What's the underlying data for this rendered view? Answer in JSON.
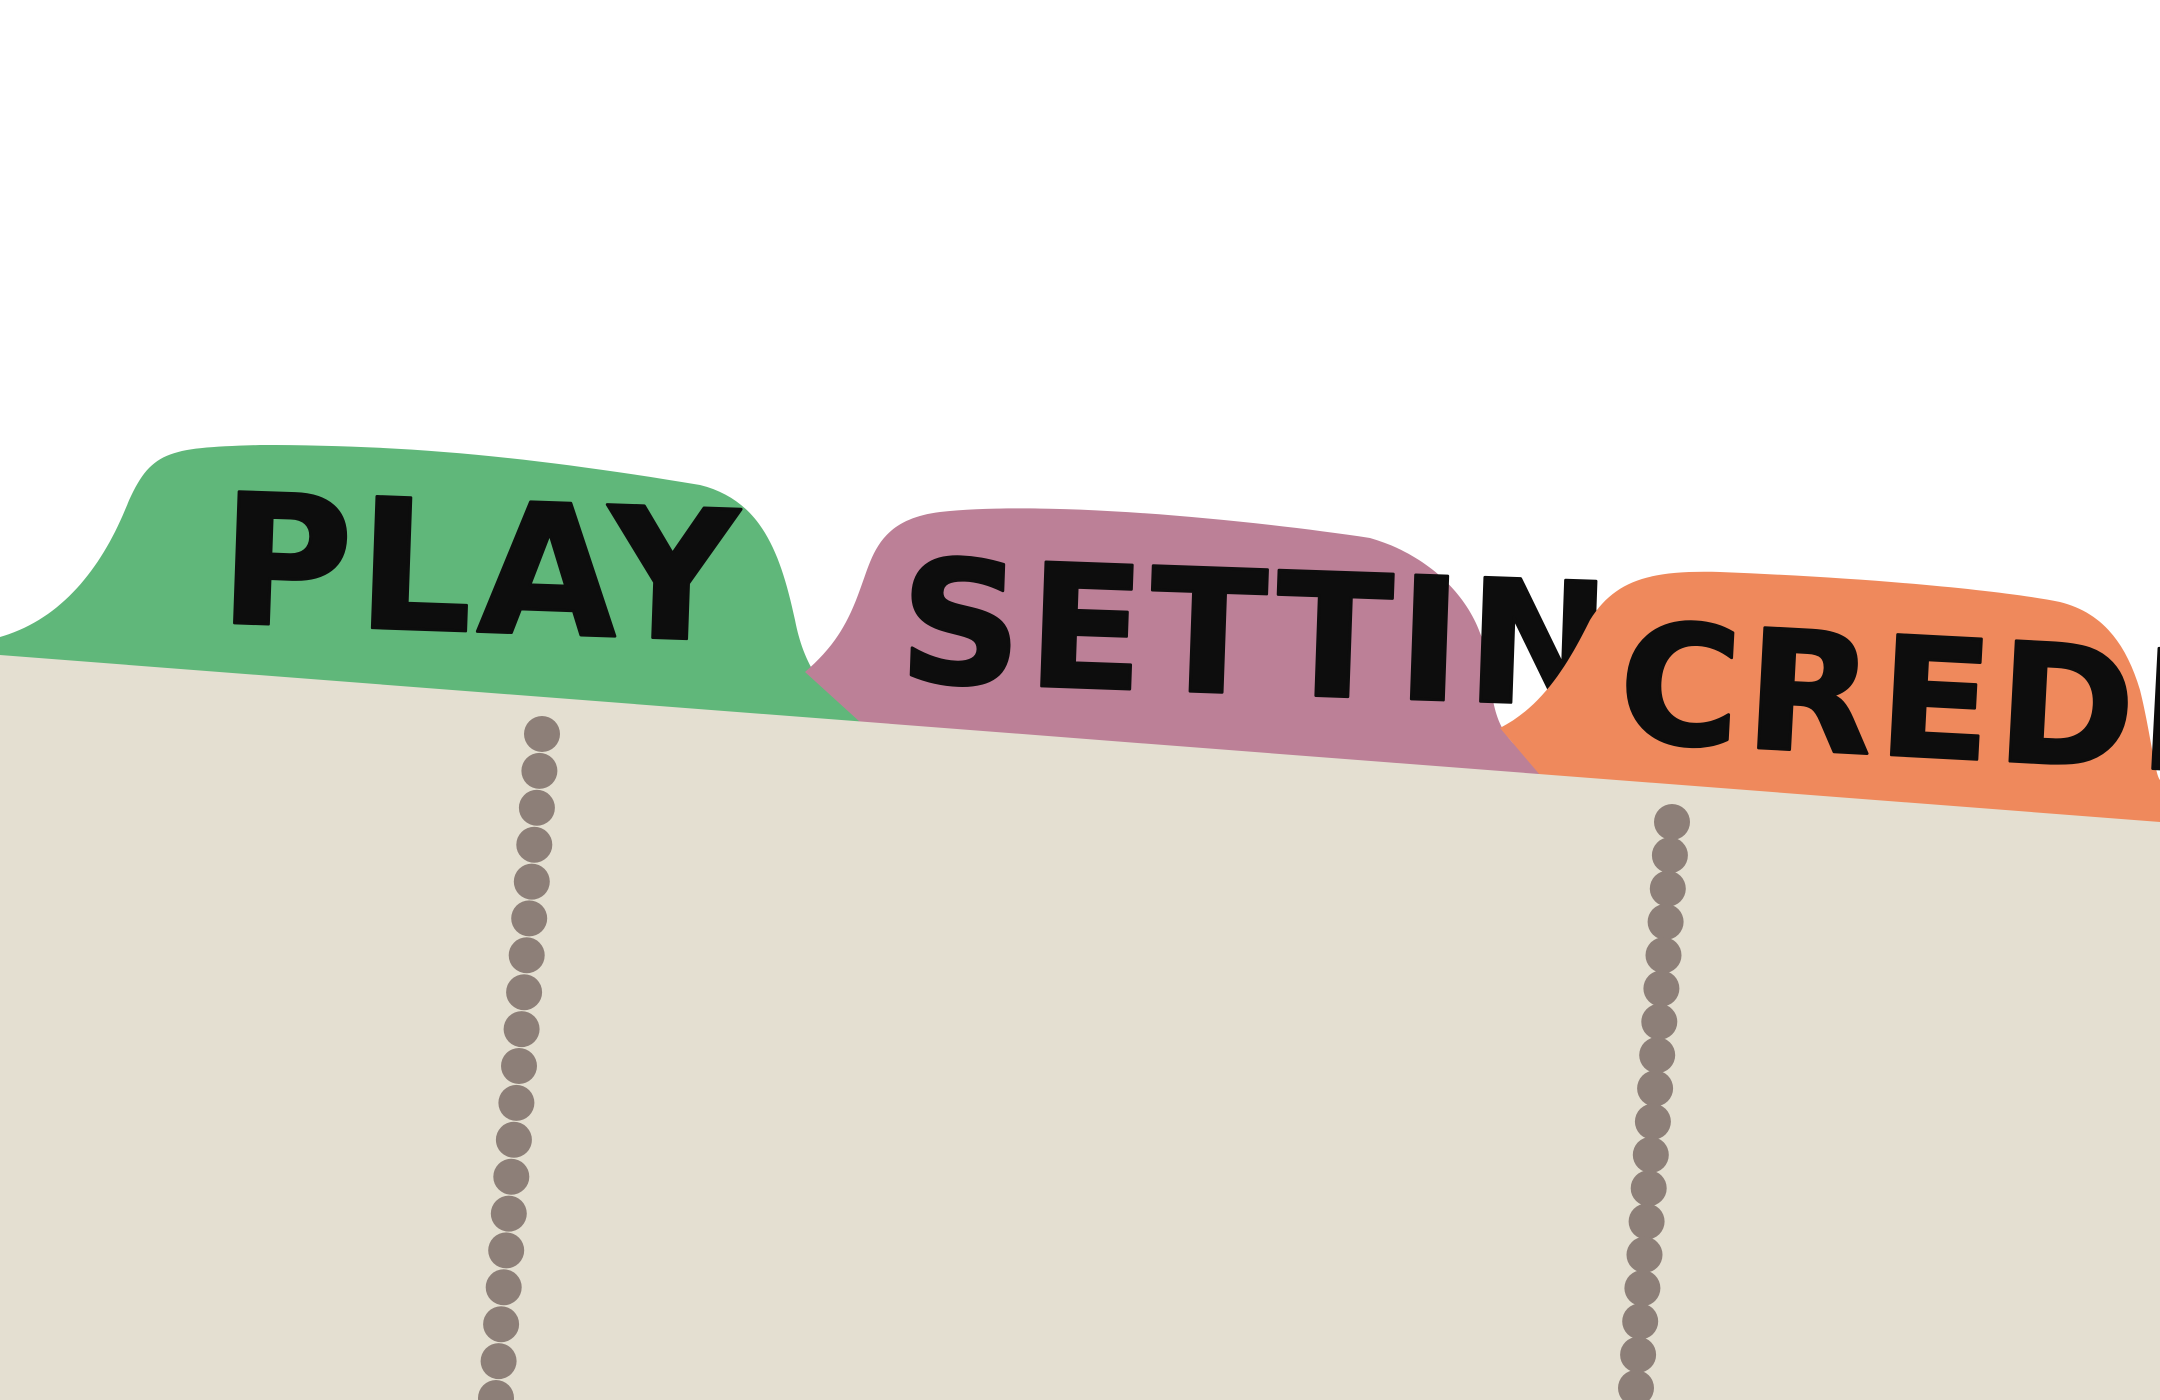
{
  "menu": {
    "tabs": [
      {
        "id": "play",
        "label": "PLAY",
        "color": "#60b77a"
      },
      {
        "id": "setting",
        "label": "SETTING",
        "color": "#bc8097"
      },
      {
        "id": "credits",
        "label": "CREDITS",
        "color": "#ef895c"
      }
    ]
  },
  "theme": {
    "background": "#ffffff",
    "paper": "#e4dfd1",
    "dot": "#8d7f78",
    "text": "#0d0d0d"
  }
}
